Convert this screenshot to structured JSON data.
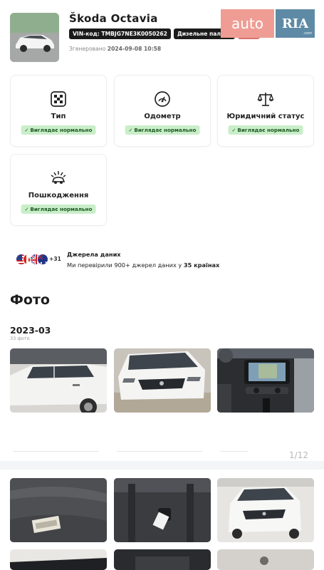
{
  "report": {
    "car_title": "Škoda Octavia",
    "vin_badge": "VIN-код: TMBJG7NE3K0050262",
    "fuel_badge": "Дизельне паливо",
    "year_badge": "2018",
    "generated_prefix": "Згенеровано ",
    "generated_at": "2024-09-08 10:58"
  },
  "logo": {
    "auto": "auto",
    "ria": "RIA",
    "domain": ".com"
  },
  "checks": [
    {
      "label": "Тип",
      "status": "Виглядає нормально",
      "icon": "taxi-icon"
    },
    {
      "label": "Одометр",
      "status": "Виглядає нормально",
      "icon": "speedometer-icon"
    },
    {
      "label": "Юридичний статус",
      "status": "Виглядає нормально",
      "icon": "scales-icon"
    },
    {
      "label": "Пошкодження",
      "status": "Виглядає нормально",
      "icon": "crash-icon"
    }
  ],
  "sources": {
    "extra_count": "+31",
    "title": "Джерела даних",
    "subtitle_prefix": "Ми перевірили 900+ джерел даних у ",
    "subtitle_bold": "35 країнах"
  },
  "photos": {
    "section_title": "Фото",
    "group_date": "2023-03",
    "group_count": "33 фото",
    "pager": "1/12"
  },
  "colors": {
    "ok_bg": "#c9eec9",
    "ok_text": "#1e5a22",
    "badge_dark": "#1b1b1b",
    "year_badge": "#d9756e",
    "logo_auto": "#ef9d94",
    "logo_ria": "#5e8aa6"
  }
}
